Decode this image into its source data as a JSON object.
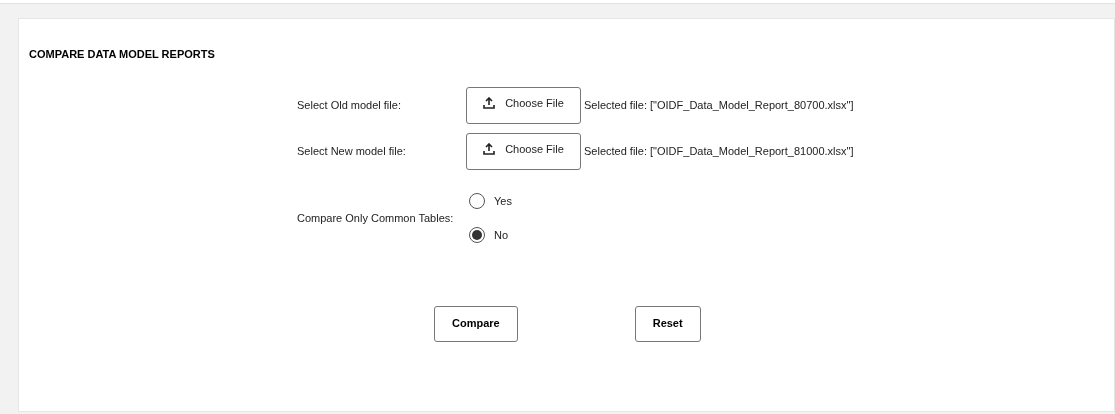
{
  "title": "COMPARE DATA MODEL REPORTS",
  "file_rows": [
    {
      "label": "Select Old model file:",
      "button": "Choose File",
      "selected_text": "Selected file: [\"OIDF_Data_Model_Report_80700.xlsx\"]"
    },
    {
      "label": "Select New model file:",
      "button": "Choose File",
      "selected_text": "Selected file: [\"OIDF_Data_Model_Report_81000.xlsx\"]"
    }
  ],
  "common_tables": {
    "label": "Compare Only Common Tables:",
    "options": [
      {
        "label": "Yes",
        "selected": false
      },
      {
        "label": "No",
        "selected": true
      }
    ]
  },
  "buttons": [
    "Compare",
    "Reset"
  ]
}
